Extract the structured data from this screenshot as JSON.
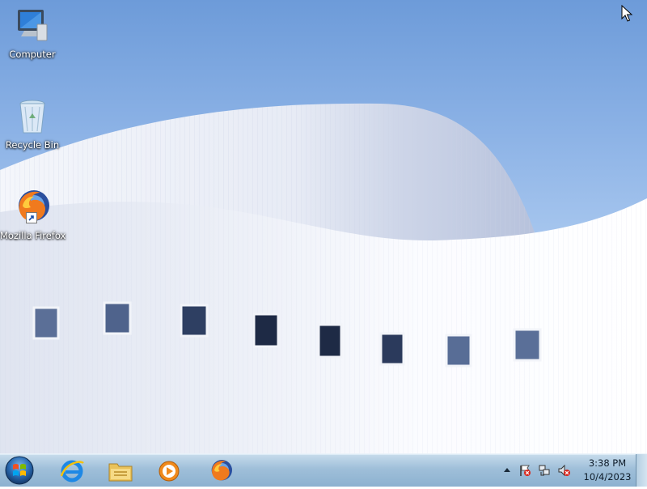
{
  "desktop": {
    "icons": [
      {
        "label": "Computer",
        "icon": "computer-icon"
      },
      {
        "label": "Recycle Bin",
        "icon": "recycle-bin-icon"
      },
      {
        "label": "Mozilla Firefox",
        "icon": "firefox-icon"
      }
    ]
  },
  "taskbar": {
    "start_icon": "windows-start-icon",
    "pinned": [
      {
        "name": "Internet Explorer",
        "icon": "internet-explorer-icon"
      },
      {
        "name": "Windows Explorer",
        "icon": "folder-icon"
      },
      {
        "name": "Windows Media Player",
        "icon": "media-player-icon"
      },
      {
        "name": "Mozilla Firefox",
        "icon": "firefox-icon"
      }
    ],
    "tray": {
      "icons": [
        "show-hidden-icons-arrow",
        "action-center-flag-icon",
        "network-icon",
        "volume-muted-icon"
      ]
    },
    "clock": {
      "time": "3:38 PM",
      "date": "10/4/2023"
    }
  },
  "colors": {
    "taskbar": "#9fbfd9",
    "sky": "#8db3e6",
    "building": "#e9eef8"
  }
}
